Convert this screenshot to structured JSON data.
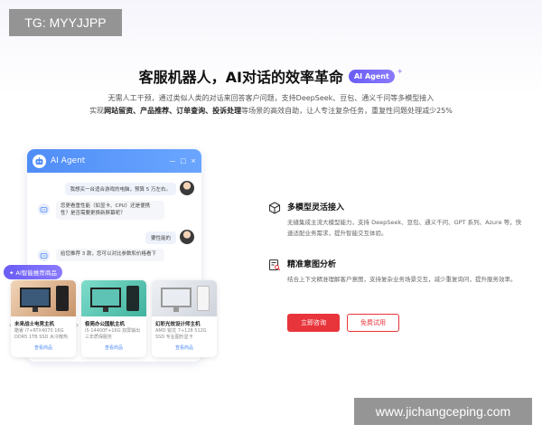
{
  "watermarks": {
    "top_left": "TG: MYYJJPP",
    "bottom_right": "www.jichangceping.com"
  },
  "hero": {
    "title": "客服机器人，AI对话的效率革命",
    "badge": "AI Agent",
    "subtitle_line1": "无需人工干预，通过类似人类的对话来回答客户问题，支持DeepSeek、豆包、通义千问等多模型接入",
    "subtitle_line2_prefix": "实现",
    "subtitle_line2_bold": "网站留资、产品推荐、订单查询、投诉处理",
    "subtitle_line2_suffix": "等场景的高效自助，让人专注复杂任务，重复性问题处理减少25%"
  },
  "chat": {
    "title": "AI Agent",
    "controls": [
      "—",
      "□",
      "×"
    ],
    "messages": [
      {
        "role": "user",
        "text": "我想买一台适合游戏的电脑，预算 5 万左右。"
      },
      {
        "role": "bot",
        "text": "您更看重性能（如显卡、CPU）还是便携性？是否需要更换新屏幕呢？"
      },
      {
        "role": "user",
        "text": "要性能的"
      },
      {
        "role": "bot",
        "text": "给您推荐 3 款，您可以对比参数和价格看下"
      }
    ],
    "recommend_tag": "✦ AI智能推荐商品",
    "products": [
      {
        "title": "未来战士电竞主机",
        "spec": "酷睿 i7+RTX4070 16G DDR5 1TB SSD 水冷散热",
        "link": "查看商品"
      },
      {
        "title": "极简办公国航主机",
        "spec": "i5-14400F+16G 双屏输出 三年质保服务",
        "link": "查看商品"
      },
      {
        "title": "幻彩光效设计师主机",
        "spec": "AMD 锐龙 7+128 512G SSD 专业图形显卡",
        "link": "查看商品"
      }
    ]
  },
  "features": [
    {
      "icon": "cube-icon",
      "title": "多模型灵活接入",
      "desc": "无缝集成主流大模型能力，支持 DeepSeek、豆包、通义千问、GPT 系列、Azure 等，快速适配业务需求，提升智能交互体验。"
    },
    {
      "icon": "document-analysis-icon",
      "title": "精准意图分析",
      "desc": "结合上下文精准理解客户意图，支持复杂业务场景交互，减少重复询问，提升服务效率。"
    }
  ],
  "buttons": {
    "primary": "立即咨询",
    "secondary": "免费试用"
  },
  "colors": {
    "accent_red": "#e8343b",
    "accent_blue": "#4f8df7",
    "accent_purple": "#6a5cf5"
  }
}
